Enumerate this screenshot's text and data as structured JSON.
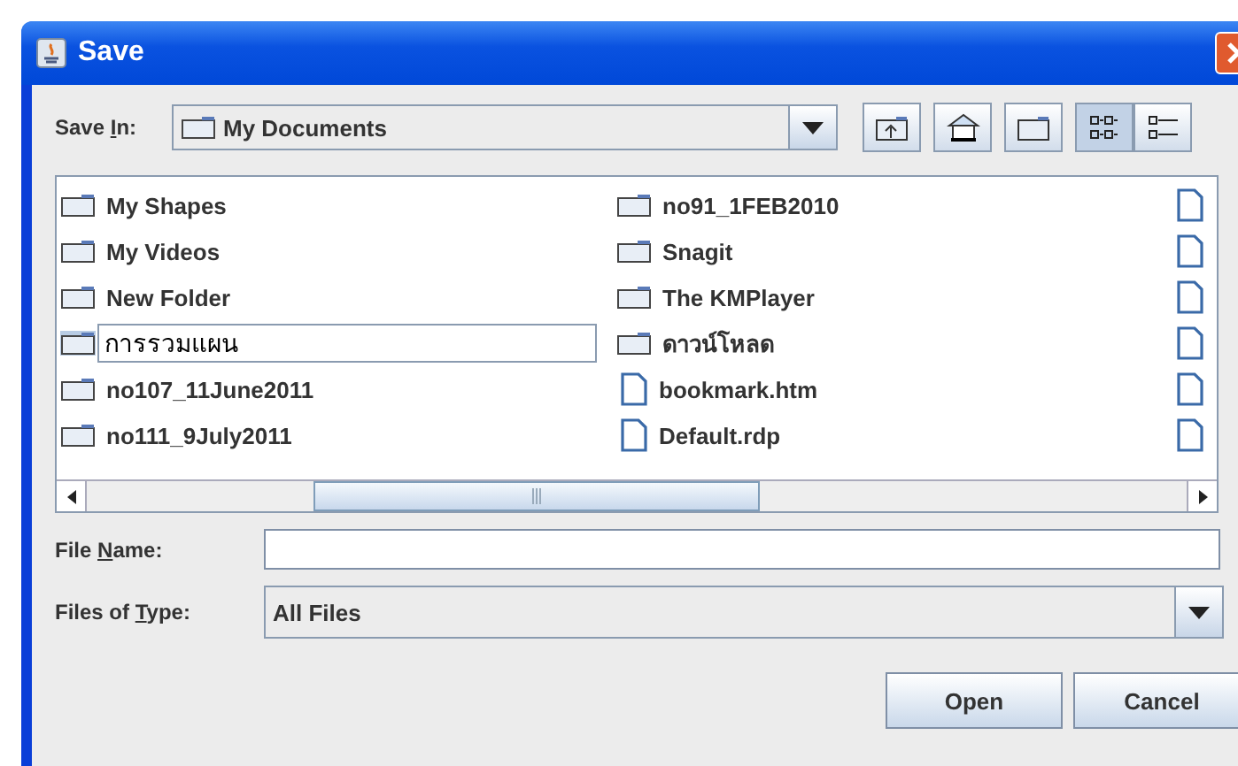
{
  "window": {
    "title": "Save"
  },
  "save_in": {
    "label": "Save In:",
    "value": "My Documents"
  },
  "toolbar": [
    {
      "kind": "up",
      "selected": false
    },
    {
      "kind": "home",
      "selected": false
    },
    {
      "kind": "new-folder",
      "selected": false
    },
    {
      "kind": "list",
      "selected": true
    },
    {
      "kind": "details",
      "selected": false
    }
  ],
  "columns": [
    [
      {
        "kind": "folder",
        "name": "My Shapes",
        "editing": false
      },
      {
        "kind": "folder",
        "name": "My Videos",
        "editing": false
      },
      {
        "kind": "folder",
        "name": "New Folder",
        "editing": false
      },
      {
        "kind": "folder",
        "name": "การรวมแผน",
        "editing": true
      },
      {
        "kind": "folder",
        "name": "no107_11June2011",
        "editing": false
      },
      {
        "kind": "folder",
        "name": "no111_9July2011",
        "editing": false
      }
    ],
    [
      {
        "kind": "folder",
        "name": "no91_1FEB2010",
        "editing": false
      },
      {
        "kind": "folder",
        "name": "Snagit",
        "editing": false
      },
      {
        "kind": "folder",
        "name": "The KMPlayer",
        "editing": false
      },
      {
        "kind": "folder",
        "name": "ดาวน์โหลด",
        "editing": false
      },
      {
        "kind": "file",
        "name": "bookmark.htm",
        "editing": false
      },
      {
        "kind": "file",
        "name": "Default.rdp",
        "editing": false
      }
    ],
    [
      {
        "kind": "file"
      },
      {
        "kind": "file"
      },
      {
        "kind": "file"
      },
      {
        "kind": "file"
      },
      {
        "kind": "file"
      },
      {
        "kind": "file"
      }
    ]
  ],
  "file_name": {
    "label": "File Name:"
  },
  "file_type": {
    "label": "Files of Type:",
    "value": "All Files"
  },
  "buttons": [
    "Open",
    "Cancel"
  ]
}
